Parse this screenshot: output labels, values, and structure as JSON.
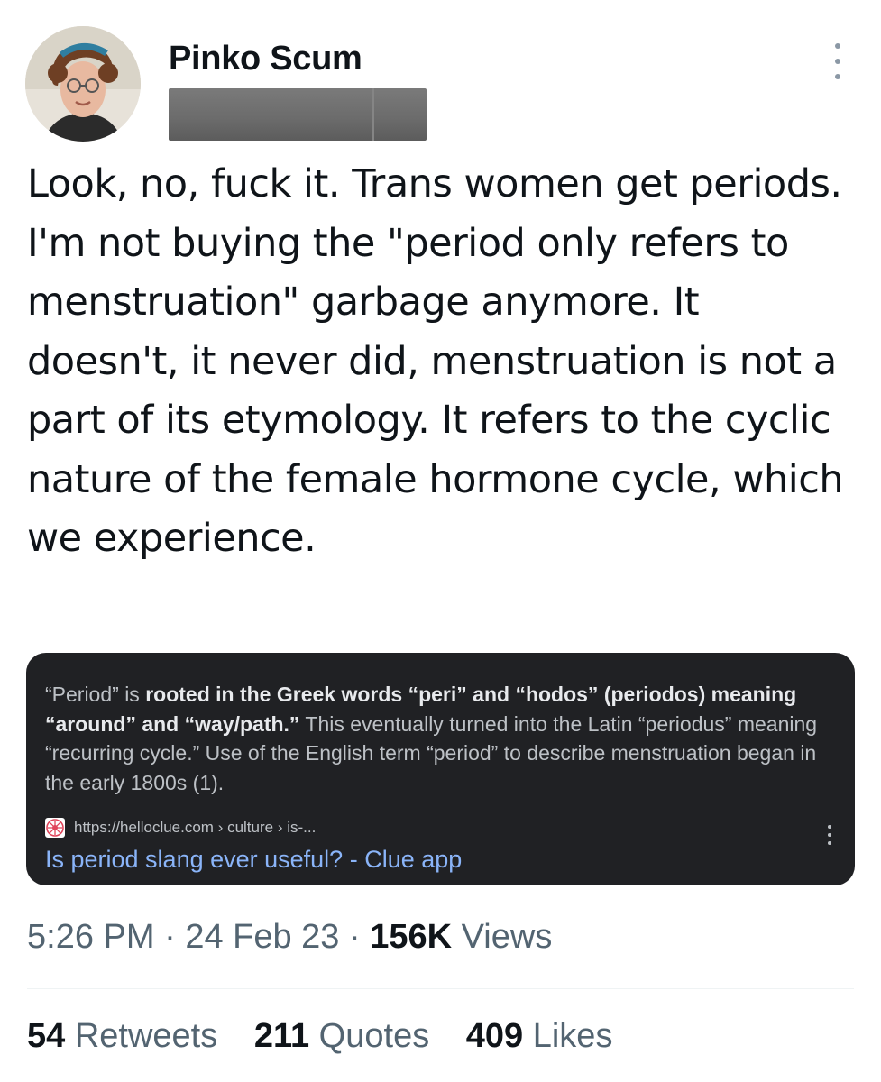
{
  "author": {
    "display_name": "Pinko Scum",
    "avatar_icon": "profile-photo"
  },
  "tweet": {
    "text": "Look, no, fuck it. Trans women get periods. I'm not buying the \"period only refers to menstruation\" garbage anymore. It doesn't, it never did, menstruation is not a part of its etymology. It refers to the cyclic nature of the female hormone cycle, which we experience."
  },
  "card": {
    "snippet_intro": "“Period” is ",
    "snippet_bold_1": "rooted in the Greek words “peri” and “hodos” (periodos) meaning “around” and “way/path.”",
    "snippet_rest": " This eventually turned into the Latin “periodus” meaning “recurring cycle.” Use of the English term “period” to describe menstruation began in the early 1800s (1).",
    "source_url": "https://helloclue.com › culture › is-...",
    "link_title": "Is period slang ever useful? - Clue app",
    "background": "#202124",
    "link_color": "#8ab4f8"
  },
  "meta": {
    "time": "5:26 PM",
    "separator": " · ",
    "date": "24 Feb 23",
    "views_count": "156K",
    "views_label": " Views"
  },
  "stats": {
    "retweets_count": "54",
    "retweets_label": " Retweets",
    "quotes_count": "211",
    "quotes_label": " Quotes",
    "likes_count": "409",
    "likes_label": " Likes"
  }
}
